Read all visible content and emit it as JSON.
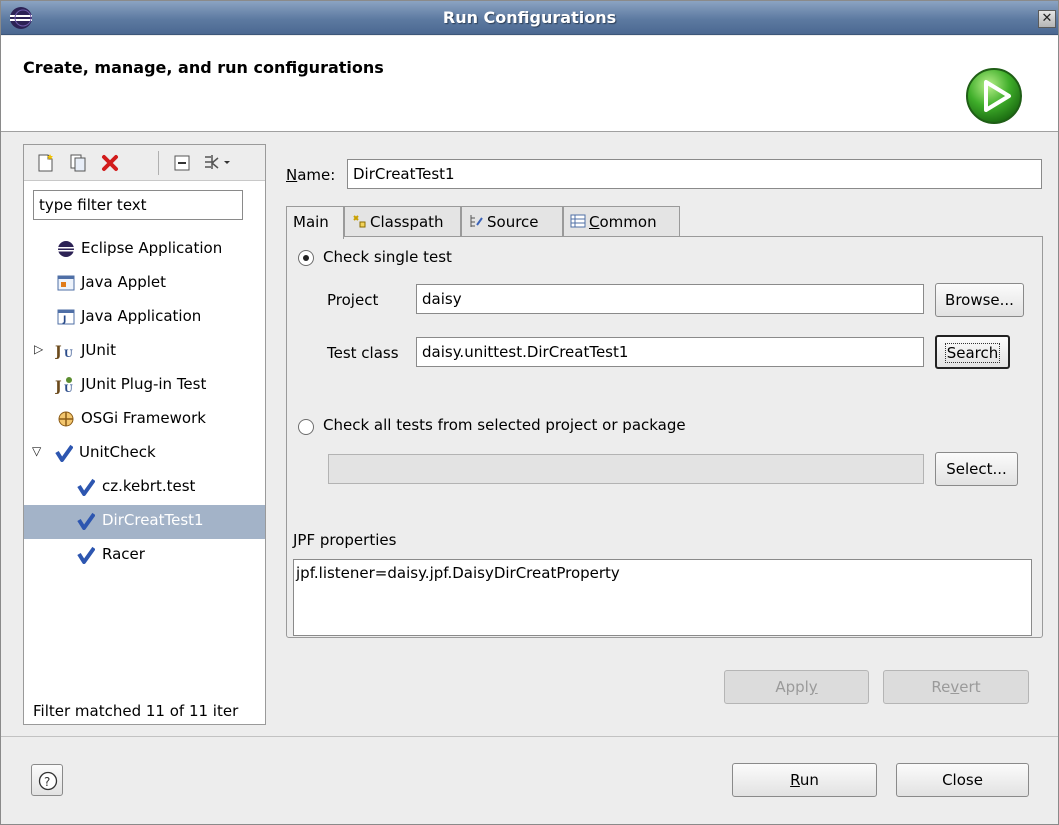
{
  "window": {
    "title": "Run Configurations"
  },
  "header": {
    "title": "Create, manage, and run configurations"
  },
  "left": {
    "filter_placeholder": "type filter text",
    "tree": [
      {
        "label": "Eclipse Application",
        "icon": "eclipse-icon"
      },
      {
        "label": "Java Applet",
        "icon": "java-applet-icon"
      },
      {
        "label": "Java Application",
        "icon": "java-application-icon"
      },
      {
        "label": "JUnit",
        "icon": "junit-icon"
      },
      {
        "label": "JUnit Plug-in Test",
        "icon": "junit-plugin-icon"
      },
      {
        "label": "OSGi Framework",
        "icon": "osgi-icon"
      },
      {
        "label": "UnitCheck",
        "icon": "unitcheck-icon"
      },
      {
        "label": "cz.kebrt.test",
        "icon": "unitcheck-icon"
      },
      {
        "label": "DirCreatTest1",
        "icon": "unitcheck-icon",
        "selected": true
      },
      {
        "label": "Racer",
        "icon": "unitcheck-icon"
      }
    ],
    "status": "Filter matched 11 of 11 iter"
  },
  "main": {
    "name_label_prefix": "N",
    "name_label_rest": "ame:",
    "name_value": "DirCreatTest1",
    "tabs": [
      {
        "label": "Main"
      },
      {
        "label": "Classpath"
      },
      {
        "label": "Source"
      },
      {
        "label_prefix": "C",
        "label_rest": "ommon"
      }
    ],
    "single_test_label": "Check single test",
    "project_label": "Project",
    "project_value": "daisy",
    "browse_label": "Browse...",
    "test_class_label": "Test class",
    "test_class_value": "daisy.unittest.DirCreatTest1",
    "search_label": "Search",
    "all_tests_label": "Check all tests from selected project or package",
    "all_tests_value": "",
    "select_label": "Select...",
    "jpf_label": "JPF properties",
    "jpf_value": "jpf.listener=daisy.jpf.DaisyDirCreatProperty",
    "apply_prefix": "Appl",
    "apply_mnemonic": "y",
    "revert_prefix": "Re",
    "revert_mnemonic": "v",
    "revert_rest": "ert"
  },
  "footer": {
    "run_mnemonic": "R",
    "run_rest": "un",
    "close_label": "Close"
  }
}
